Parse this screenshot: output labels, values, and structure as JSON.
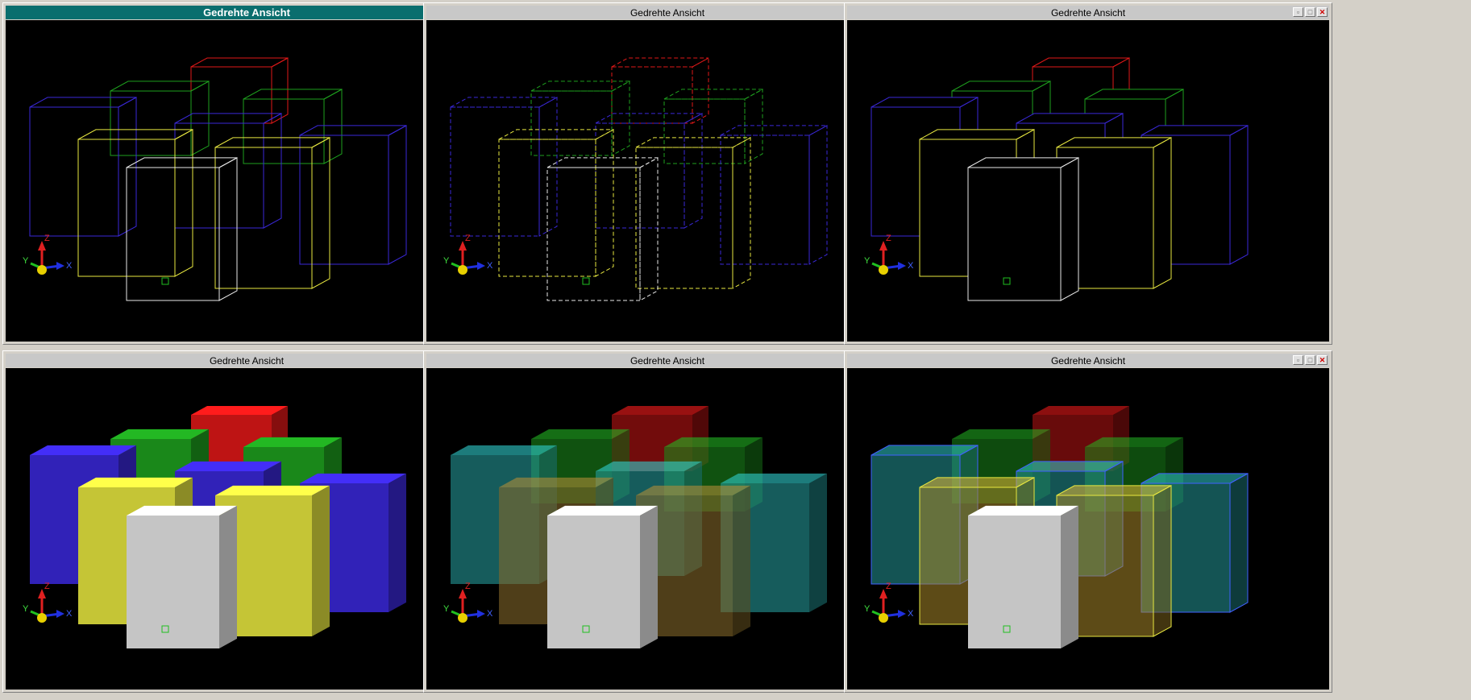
{
  "windows": [
    {
      "title": "Gedrehte Ansicht",
      "active": true,
      "mode": "hidden-dotted-wireframe"
    },
    {
      "title": "Gedrehte Ansicht",
      "active": false,
      "mode": "hidden-dashed-wireframe"
    },
    {
      "title": "Gedrehte Ansicht",
      "active": false,
      "mode": "hidden-line-removed"
    },
    {
      "title": "Gedrehte Ansicht",
      "active": false,
      "mode": "shaded"
    },
    {
      "title": "Gedrehte Ansicht",
      "active": false,
      "mode": "transparent-shaded"
    },
    {
      "title": "Gedrehte Ansicht",
      "active": false,
      "mode": "transparent-shaded-with-edges"
    }
  ],
  "axis_labels": {
    "x": "X",
    "y": "Y",
    "z": "Z"
  },
  "controls": {
    "minimize": "▫",
    "maximize": "□",
    "close": "✕"
  },
  "colors": {
    "blue": "#3a28d8",
    "green": "#1ea01e",
    "red": "#e01818",
    "yellow": "#e8e840",
    "white": "#e8e8e8",
    "cyan": "#2ab4b4",
    "active_title": "#0a6e6e"
  }
}
